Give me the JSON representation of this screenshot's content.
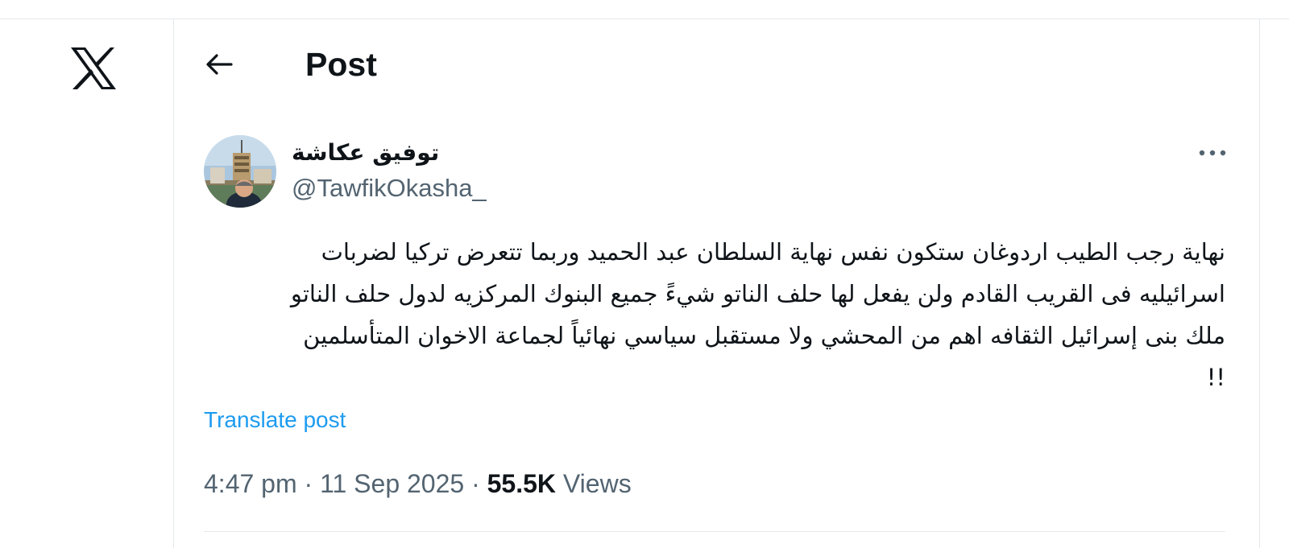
{
  "brand": {
    "logo_icon": "x-logo-icon",
    "color": "#0f1419"
  },
  "header": {
    "back_icon": "back-arrow-icon",
    "title": "Post"
  },
  "post": {
    "author": {
      "display_name": "توفيق عكاشة",
      "handle": "@TawfikOkasha_",
      "avatar_icon": "avatar"
    },
    "more_icon": "more-dots-icon",
    "text_lines": [
      "نهاية رجب الطيب اردوغان ستكون نفس نهاية السلطان عبد الحميد وربما تتعرض تركيا لضربات",
      "اسرائيليه فى القريب القادم ولن يفعل لها حلف الناتو شيءً جميع البنوك المركزيه لدول حلف الناتو",
      "ملك بنى إسرائيل الثقافه اهم من المحشي ولا مستقبل سياسي نهائياً لجماعة الاخوان المتأسلمين",
      "!!"
    ],
    "translate_label": "Translate post",
    "time": "4:47 pm",
    "separator": "·",
    "date": "11 Sep 2025",
    "views_count": "55.5K",
    "views_label": "Views"
  },
  "colors": {
    "text_primary": "#0f1419",
    "text_secondary": "#536471",
    "link": "#1d9bf0",
    "border": "#e6e9ec"
  }
}
